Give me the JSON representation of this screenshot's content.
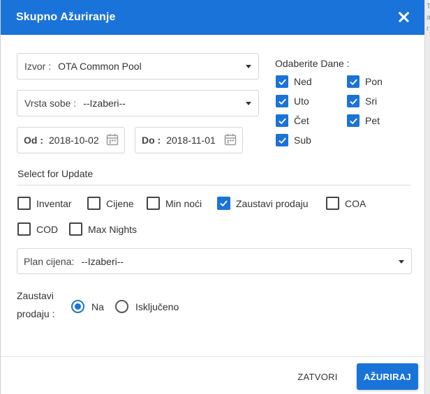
{
  "modal": {
    "title": "Skupno Ažuriranje",
    "close_icon": "close-icon"
  },
  "side_text": [
    "T",
    "a",
    "r"
  ],
  "source": {
    "label": "Izvor :",
    "value": "OTA Common Pool"
  },
  "room_type": {
    "label": "Vrsta sobe :",
    "value": "--Izaberi--"
  },
  "date_from": {
    "label": "Od :",
    "value": "2018-10-02"
  },
  "date_to": {
    "label": "Do :",
    "value": "2018-11-01"
  },
  "days": {
    "title": "Odaberite Dane :",
    "items": [
      {
        "label": "Ned",
        "checked": true
      },
      {
        "label": "Pon",
        "checked": true
      },
      {
        "label": "Uto",
        "checked": true
      },
      {
        "label": "Sri",
        "checked": true
      },
      {
        "label": "Čet",
        "checked": true
      },
      {
        "label": "Pet",
        "checked": true
      },
      {
        "label": "Sub",
        "checked": true
      }
    ]
  },
  "update_section": {
    "title": "Select for Update",
    "options": [
      {
        "label": "Inventar",
        "checked": false
      },
      {
        "label": "Cijene",
        "checked": false
      },
      {
        "label": "Min noći",
        "checked": false
      },
      {
        "label": "Zaustavi prodaju",
        "checked": true
      },
      {
        "label": "COA",
        "checked": false
      },
      {
        "label": "COD",
        "checked": false
      },
      {
        "label": "Max Nights",
        "checked": false
      }
    ]
  },
  "rate_plan": {
    "label": "Plan cijena:",
    "value": "--Izaberi--"
  },
  "stop_sale": {
    "label": "Zaustavi prodaju :",
    "options": [
      {
        "label": "Na",
        "selected": true
      },
      {
        "label": "Isključeno",
        "selected": false
      }
    ]
  },
  "footer": {
    "close_label": "ZATVORI",
    "update_label": "AŽURIRAJ"
  },
  "colors": {
    "primary": "#1a73d9",
    "border": "#d6d6d6"
  }
}
